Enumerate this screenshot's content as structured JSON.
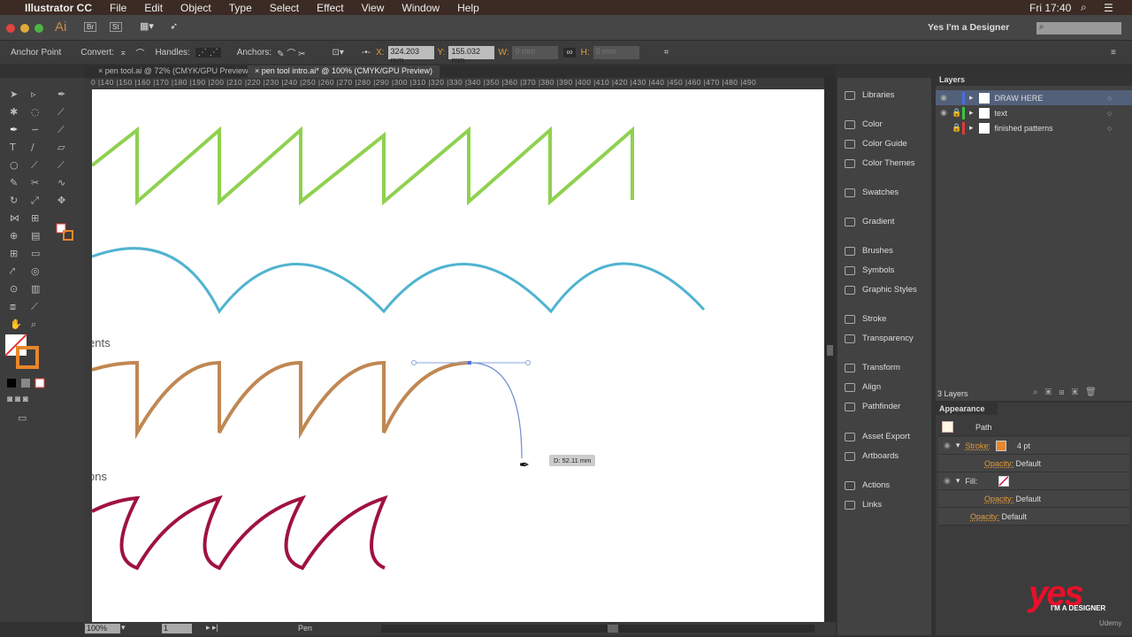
{
  "menubar": {
    "app": "Illustrator CC",
    "items": [
      "File",
      "Edit",
      "Object",
      "Type",
      "Select",
      "Effect",
      "View",
      "Window",
      "Help"
    ],
    "clock": "Fri 17:40"
  },
  "appbar": {
    "logo": "Ai",
    "bridge": "Br",
    "stock": "St",
    "workspace": "Yes I'm a Designer",
    "search_placeholder": ""
  },
  "control": {
    "anchor_point": "Anchor Point",
    "convert": "Convert:",
    "handles": "Handles:",
    "anchors": "Anchors:",
    "x_label": "X:",
    "x": "324.203 mm",
    "y_label": "Y:",
    "y": "155.032 mm",
    "w_label": "W:",
    "w": "0 mm",
    "h_label": "H:",
    "h": "0 mm"
  },
  "tabs": [
    {
      "label": "pen tool.ai @ 72% (CMYK/GPU Preview)"
    },
    {
      "label": "pen tool intro.ai* @ 100% (CMYK/GPU Preview)"
    }
  ],
  "ruler": "0 |140 |150 |160 |170 |180 |190 |200 |210 |220 |230 |240 |250 |260 |270 |280 |290 |300 |310 |320 |330 |340 |350 |360 |370 |380 |390 |400 |410 |420 |430 |440 |450 |460 |470 |480 |490",
  "canvas": {
    "label1": "ents",
    "label2": "ons",
    "distance": "D: 52.11 mm",
    "colors": {
      "green": "#8fd14f",
      "blue": "#4fb3d0",
      "brown": "#c08752",
      "red": "#a0123f",
      "path": "#6a8fd0"
    }
  },
  "status": {
    "zoom": "100%",
    "artboard": "1",
    "tool": "Pen"
  },
  "dock": [
    "Libraries",
    "Color",
    "Color Guide",
    "Color Themes",
    "Swatches",
    "Gradient",
    "Brushes",
    "Symbols",
    "Graphic Styles",
    "Stroke",
    "Transparency",
    "Transform",
    "Align",
    "Pathfinder",
    "Asset Export",
    "Artboards",
    "Actions",
    "Links"
  ],
  "layers": {
    "title": "Layers",
    "items": [
      {
        "name": "DRAW HERE",
        "color": "#4a6de0"
      },
      {
        "name": "text",
        "color": "#3fc33f"
      },
      {
        "name": "finished patterns",
        "color": "#e03a3a"
      }
    ],
    "count": "3 Layers"
  },
  "appearance": {
    "title": "Appearance",
    "path": "Path",
    "stroke": "Stroke:",
    "stroke_weight": "4 pt",
    "fill": "Fill:",
    "opacity": "Opacity:",
    "default": "Default",
    "stroke_color": "#e8872a"
  },
  "watermark": {
    "brand": "yes",
    "sub": "I'M A DESIGNER",
    "udemy": "Udemy"
  }
}
